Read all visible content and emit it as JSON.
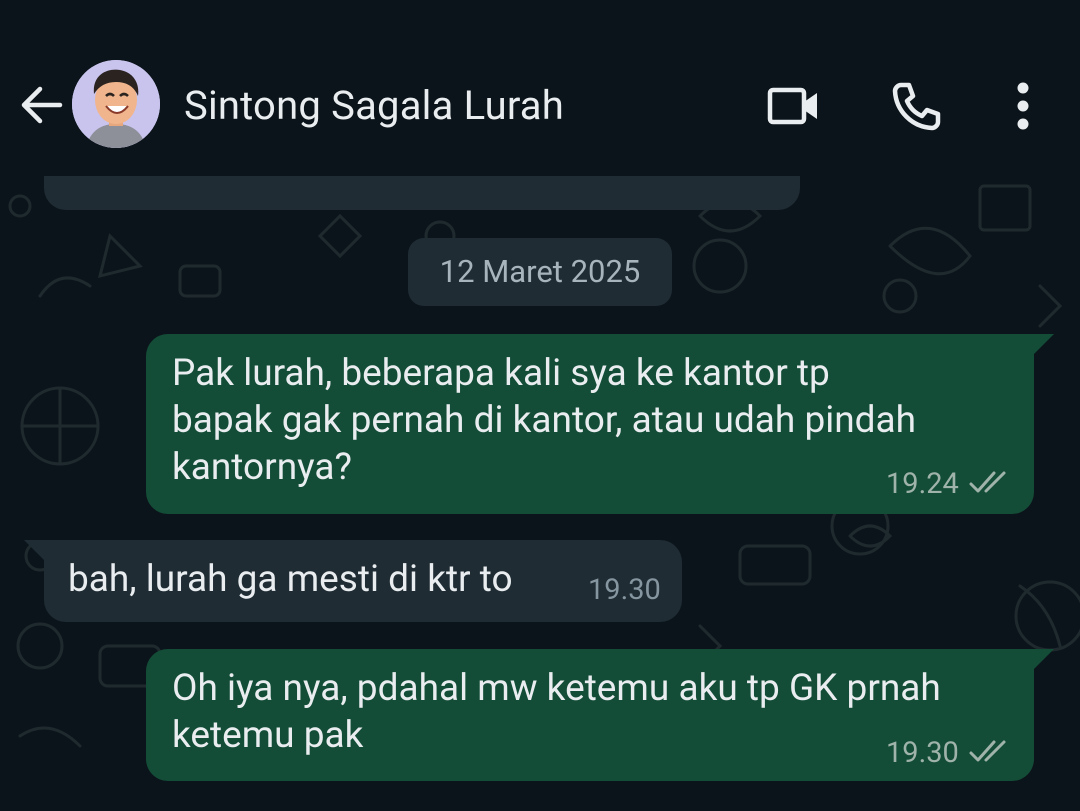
{
  "header": {
    "contact_name": "Sintong Sagala Lurah",
    "icons": [
      "back-arrow-icon",
      "video-call-icon",
      "phone-icon",
      "more-options-icon"
    ]
  },
  "chat": {
    "date_divider": "12 Maret 2025",
    "messages": [
      {
        "direction": "outgoing",
        "text": "Pak lurah, beberapa kali sya ke kantor tp\nbapak gak pernah di kantor, atau udah pindah\nkantornya?",
        "time": "19.24",
        "status": "read"
      },
      {
        "direction": "incoming",
        "text": "bah, lurah ga mesti di ktr to",
        "time": "19.30"
      },
      {
        "direction": "outgoing",
        "text": "Oh iya nya, pdahal mw ketemu aku tp GK prnah\nketemu pak",
        "time": "19.30",
        "status": "read"
      }
    ]
  },
  "colors": {
    "background": "#0b141a",
    "outgoing_bubble": "#144d37",
    "incoming_bubble": "#1f2c34",
    "read_ticks": "#9fb3ab"
  }
}
